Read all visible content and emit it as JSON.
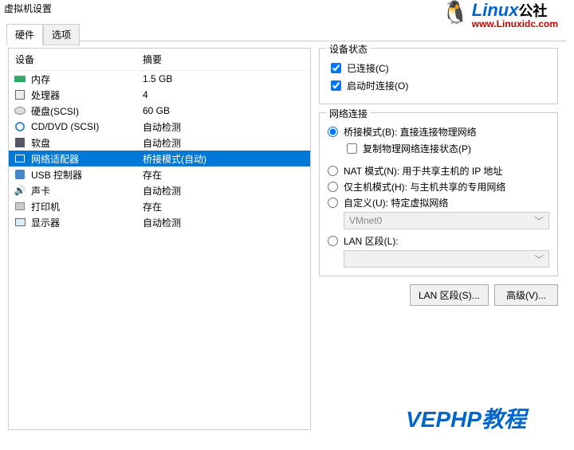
{
  "window_title": "虚拟机设置",
  "logo": {
    "brand": "Linux",
    "suffix": "公社",
    "url": "www.Linuxidc.com"
  },
  "tabs": {
    "hardware": "硬件",
    "options": "选项",
    "active": "hardware"
  },
  "list": {
    "header_device": "设备",
    "header_summary": "摘要",
    "rows": [
      {
        "icon": "memory",
        "name": "内存",
        "summary": "1.5 GB"
      },
      {
        "icon": "cpu",
        "name": "处理器",
        "summary": "4"
      },
      {
        "icon": "hdd",
        "name": "硬盘(SCSI)",
        "summary": "60 GB"
      },
      {
        "icon": "cd",
        "name": "CD/DVD (SCSI)",
        "summary": "自动检测"
      },
      {
        "icon": "floppy",
        "name": "软盘",
        "summary": "自动检测"
      },
      {
        "icon": "net",
        "name": "网络适配器",
        "summary": "桥接模式(自动)",
        "selected": true
      },
      {
        "icon": "usb",
        "name": "USB 控制器",
        "summary": "存在"
      },
      {
        "icon": "sound",
        "name": "声卡",
        "summary": "自动检测"
      },
      {
        "icon": "printer",
        "name": "打印机",
        "summary": "存在"
      },
      {
        "icon": "display",
        "name": "显示器",
        "summary": "自动检测"
      }
    ]
  },
  "device_state": {
    "group_title": "设备状态",
    "connected": {
      "label": "已连接(C)",
      "checked": true
    },
    "connect_at_power": {
      "label": "启动时连接(O)",
      "checked": true
    }
  },
  "net_conn": {
    "group_title": "网络连接",
    "bridged": {
      "label": "桥接模式(B): 直接连接物理网络",
      "checked": true
    },
    "replicate": {
      "label": "复制物理网络连接状态(P)",
      "checked": false
    },
    "nat": {
      "label": "NAT 模式(N): 用于共享主机的 IP 地址",
      "checked": false
    },
    "hostonly": {
      "label": "仅主机模式(H): 与主机共享的专用网络",
      "checked": false
    },
    "custom": {
      "label": "自定义(U): 特定虚拟网络",
      "checked": false
    },
    "custom_value": "VMnet0",
    "lan_segment": {
      "label": "LAN 区段(L):",
      "checked": false
    }
  },
  "buttons": {
    "lan_segments": "LAN 区段(S)...",
    "advanced": "高级(V)..."
  },
  "watermark": "VEPHP教程"
}
